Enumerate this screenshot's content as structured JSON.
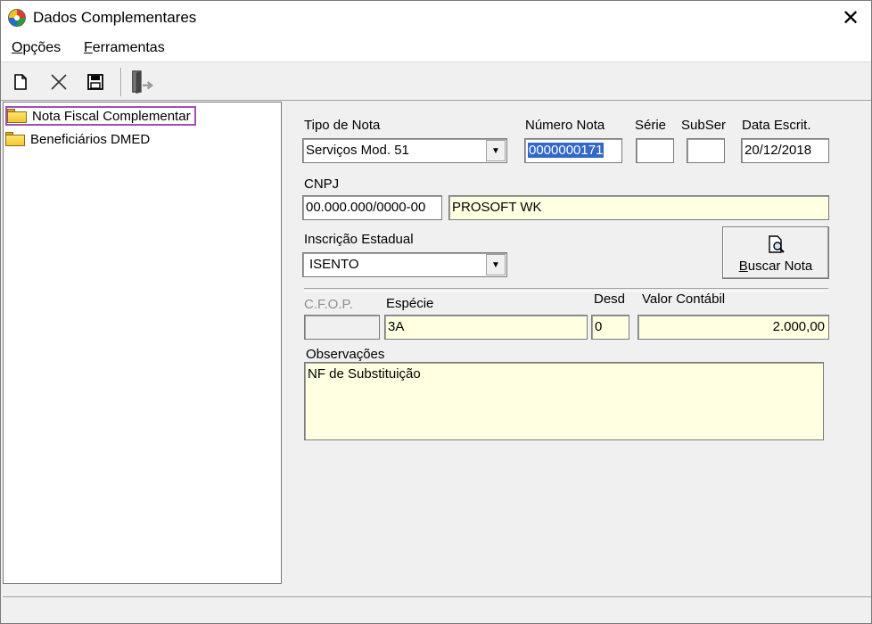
{
  "window": {
    "title": "Dados Complementares",
    "close_glyph": "✕",
    "icon": "app-globe-icon"
  },
  "menu": {
    "opcoes": "Opções",
    "ferramentas": "Ferramentas"
  },
  "toolbar": {
    "buttons": [
      "new-document-icon",
      "delete-x-icon",
      "save-floppy-icon",
      "exit-door-icon"
    ]
  },
  "tree": {
    "items": [
      {
        "label": "Nota Fiscal Complementar",
        "icon": "open-folder-icon",
        "selected": true
      },
      {
        "label": "Beneficiários DMED",
        "icon": "folder-icon",
        "selected": false
      }
    ]
  },
  "form": {
    "tipo_nota": {
      "label": "Tipo de Nota",
      "value": "Serviços Mod. 51"
    },
    "numero_nota": {
      "label": "Número Nota",
      "value": "0000000171"
    },
    "serie": {
      "label": "Série",
      "value": ""
    },
    "subser": {
      "label": "SubSer",
      "value": ""
    },
    "data_escrit": {
      "label": "Data Escrit.",
      "value": "20/12/2018"
    },
    "cnpj": {
      "label": "CNPJ",
      "value": "00.000.000/0000-00",
      "name_value": "PROSOFT WK"
    },
    "inscricao": {
      "label": "Inscrição Estadual",
      "value": "ISENTO"
    },
    "buscar_nota": {
      "label_prefix": "B",
      "label_rest": "uscar Nota"
    },
    "cfop": {
      "label": "C.F.O.P.",
      "value": ""
    },
    "especie": {
      "label": "Espécie",
      "value": "3A"
    },
    "desd": {
      "label": "Desd",
      "value": "0"
    },
    "valor_contabil": {
      "label": "Valor Contábil",
      "value": "2.000,00"
    },
    "observacoes": {
      "label": "Observações",
      "value": "NF de Substituição"
    }
  },
  "colors": {
    "selection_border": "#a14fb3",
    "selection_fill": "#3268c8",
    "readonly_fill": "#ffffe1"
  }
}
